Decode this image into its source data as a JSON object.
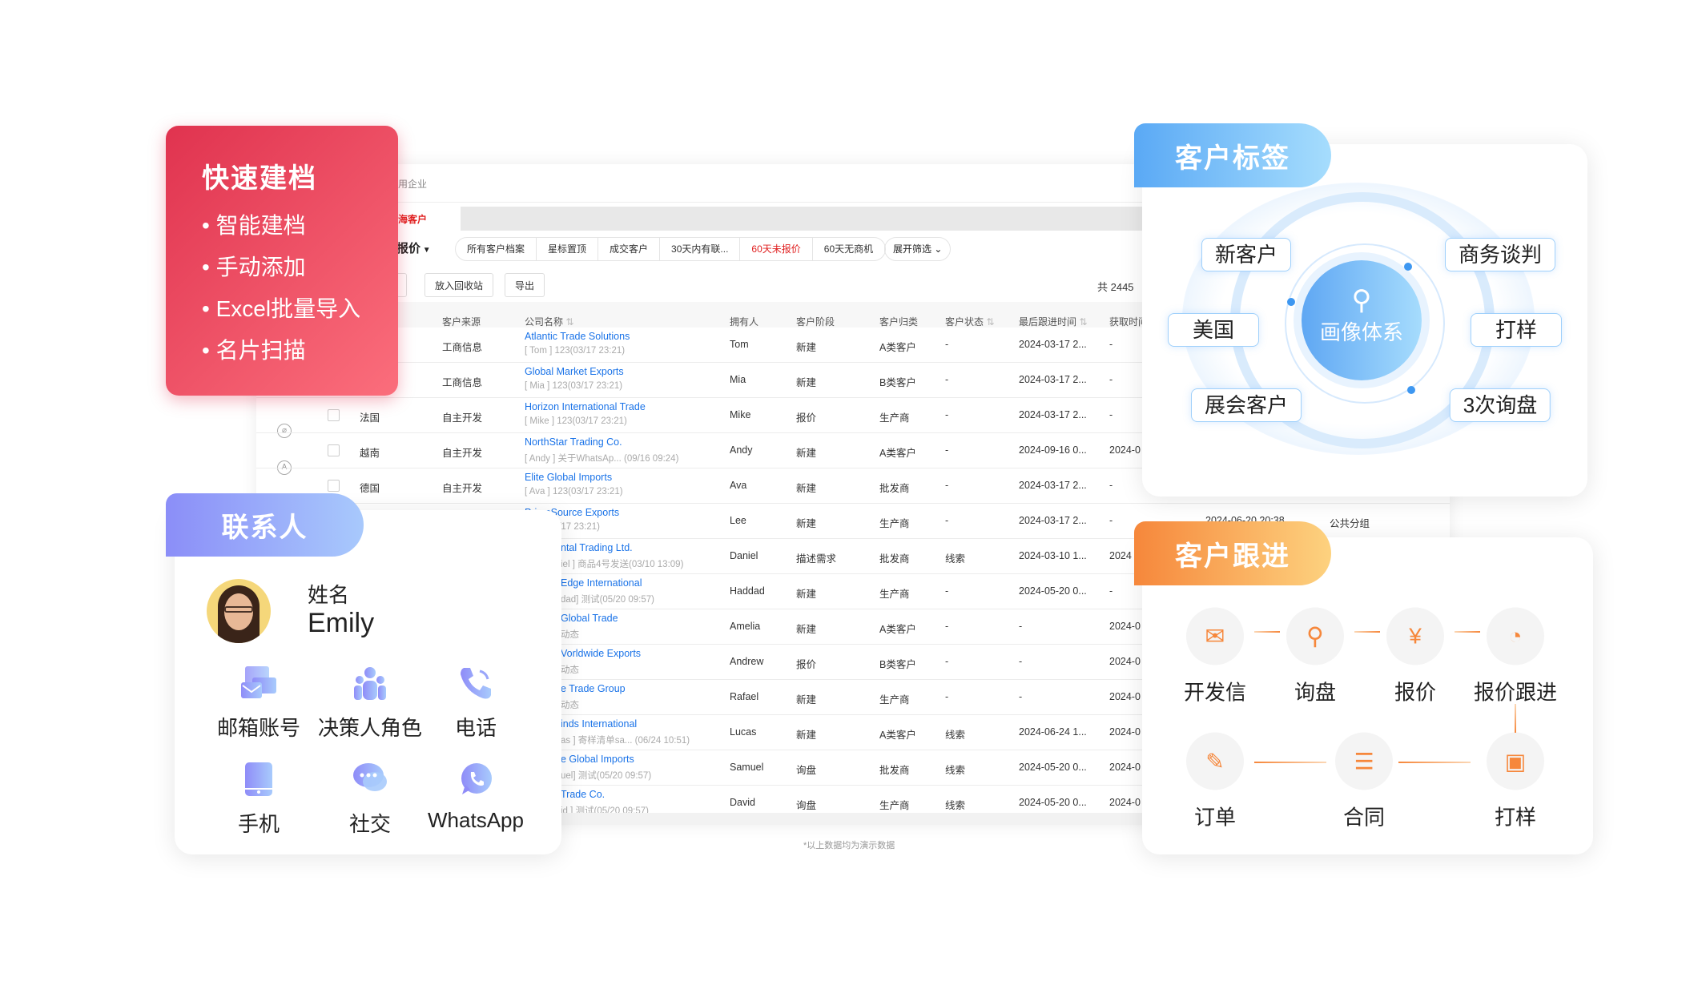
{
  "crm": {
    "nav_crumb": "用企业",
    "active_tab": "海客户",
    "view_selector": "未报价",
    "filter_chips": [
      "所有客户档案",
      "星标置顶",
      "成交客户",
      "30天内有联...",
      "60天未报价",
      "60天无商机"
    ],
    "active_chip_index": 4,
    "expand_filter": "展开筛选",
    "actions": [
      "取",
      "放入回收站",
      "导出"
    ],
    "total": "共 2445",
    "columns": [
      "客户来源",
      "公司名称",
      "拥有人",
      "客户阶段",
      "客户归类",
      "客户状态",
      "最后跟进时间",
      "获取时间"
    ],
    "sortable_columns": [
      "公司名称",
      "客户状态",
      "最后跟进时间"
    ],
    "rows": [
      {
        "country": "",
        "source": "工商信息",
        "company": "Atlantic Trade Solutions",
        "sub": "[ Tom ] 123(03/17 23:21)",
        "owner": "Tom",
        "stage": "新建",
        "category": "A类客户",
        "status": "-",
        "last": "2024-03-17 2...",
        "acquired": "-"
      },
      {
        "country": "",
        "source": "工商信息",
        "company": "Global Market Exports",
        "sub": "[ Mia ] 123(03/17 23:21)",
        "owner": "Mia",
        "stage": "新建",
        "category": "B类客户",
        "status": "-",
        "last": "2024-03-17 2...",
        "acquired": "-"
      },
      {
        "country": "法国",
        "source": "自主开发",
        "company": "Horizon International Trade",
        "sub": "[ Mike ] 123(03/17 23:21)",
        "owner": "Mike",
        "stage": "报价",
        "category": "生产商",
        "status": "-",
        "last": "2024-03-17 2...",
        "acquired": "-"
      },
      {
        "country": "越南",
        "source": "自主开发",
        "company": "NorthStar Trading Co.",
        "sub": "[ Andy ] 关于WhatsAp... (09/16 09:24)",
        "owner": "Andy",
        "stage": "新建",
        "category": "A类客户",
        "status": "-",
        "last": "2024-09-16 0...",
        "acquired": "2024-0"
      },
      {
        "country": "德国",
        "source": "自主开发",
        "company": "Elite Global Imports",
        "sub": "[ Ava ] 123(03/17 23:21)",
        "owner": "Ava",
        "stage": "新建",
        "category": "批发商",
        "status": "-",
        "last": "2024-03-17 2...",
        "acquired": "-"
      },
      {
        "country": "",
        "source": "",
        "company": "PrimeSource Exports",
        "sub": "] 123(03/17 23:21)",
        "owner": "Lee",
        "stage": "新建",
        "category": "生产商",
        "status": "-",
        "last": "2024-03-17 2...",
        "acquired": "-",
        "extra1": "2024-06-20 20:38",
        "extra2": "公共分组"
      },
      {
        "country": "",
        "source": "",
        "company": "ntal Trading Ltd.",
        "sub": "iel ] 商品4号发送(03/10 13:09)",
        "owner": "Daniel",
        "stage": "描述需求",
        "category": "批发商",
        "status": "线索",
        "last": "2024-03-10 1...",
        "acquired": "2024"
      },
      {
        "country": "",
        "source": "",
        "company": "Edge International",
        "sub": "dad] 测试(05/20 09:57)",
        "owner": "Haddad",
        "stage": "新建",
        "category": "生产商",
        "status": "-",
        "last": "2024-05-20 0...",
        "acquired": "-"
      },
      {
        "country": "",
        "source": "",
        "company": "Global Trade",
        "sub": "动态",
        "owner": "Amelia",
        "stage": "新建",
        "category": "A类客户",
        "status": "-",
        "last": "-",
        "acquired": "2024-0"
      },
      {
        "country": "",
        "source": "",
        "company": "Vorldwide Exports",
        "sub": "动态",
        "owner": "Andrew",
        "stage": "报价",
        "category": "B类客户",
        "status": "-",
        "last": "-",
        "acquired": "2024-0"
      },
      {
        "country": "",
        "source": "",
        "company": "e Trade Group",
        "sub": "动态",
        "owner": "Rafael",
        "stage": "新建",
        "category": "生产商",
        "status": "-",
        "last": "-",
        "acquired": "2024-0"
      },
      {
        "country": "",
        "source": "",
        "company": "inds International",
        "sub": "as ] 寄样清单sa... (06/24 10:51)",
        "owner": "Lucas",
        "stage": "新建",
        "category": "A类客户",
        "status": "线索",
        "last": "2024-06-24 1...",
        "acquired": "2024-0"
      },
      {
        "country": "",
        "source": "",
        "company": "e Global Imports",
        "sub": "uel] 测试(05/20 09:57)",
        "owner": "Samuel",
        "stage": "询盘",
        "category": "批发商",
        "status": "线索",
        "last": "2024-05-20 0...",
        "acquired": "2024-0"
      },
      {
        "country": "",
        "source": "",
        "company": "Trade Co.",
        "sub": "id ] 测试(05/20 09:57)",
        "owner": "David",
        "stage": "询盘",
        "category": "生产商",
        "status": "线索",
        "last": "2024-05-20 0...",
        "acquired": "2024-0"
      }
    ],
    "footnote": "*以上数据均为演示数据"
  },
  "quick_create": {
    "title": "快速建档",
    "items": [
      "智能建档",
      "手动添加",
      "Excel批量导入",
      "名片扫描"
    ]
  },
  "contacts": {
    "title": "联系人",
    "name_label": "姓名",
    "name": "Emily",
    "items": [
      {
        "label": "邮箱账号",
        "icon": "mailbox-icon"
      },
      {
        "label": "决策人角色",
        "icon": "people-icon"
      },
      {
        "label": "电话",
        "icon": "phone-icon"
      },
      {
        "label": "手机",
        "icon": "mobile-icon"
      },
      {
        "label": "社交",
        "icon": "chat-icon"
      },
      {
        "label": "WhatsApp",
        "icon": "whatsapp-icon"
      }
    ]
  },
  "tags": {
    "title": "客户标签",
    "center": "画像体系",
    "items": [
      "新客户",
      "商务谈判",
      "美国",
      "打样",
      "展会客户",
      "3次询盘"
    ]
  },
  "followup": {
    "title": "客户跟进",
    "steps": [
      "开发信",
      "询盘",
      "报价",
      "报价跟进",
      "打样",
      "合同",
      "订单"
    ]
  },
  "colors": {
    "red_card": "#e8415a",
    "contact_accent": "#8f9cfb",
    "tag_accent": "#5aa9f5",
    "follow_accent": "#f6873b",
    "link": "#1a73e8",
    "active_chip": "#e02020"
  }
}
